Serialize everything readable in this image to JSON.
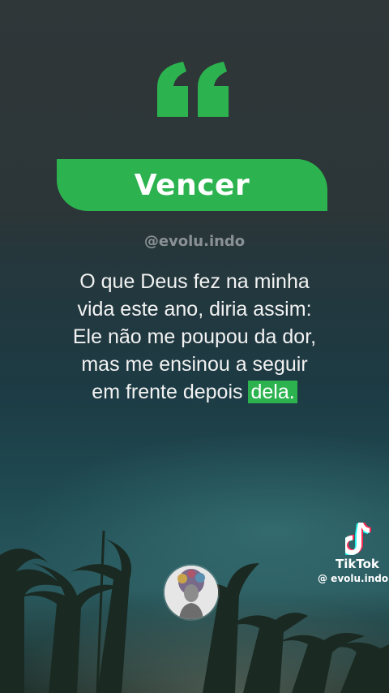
{
  "quote_card": {
    "title": "Vencer",
    "handle": "@evolu.indo",
    "lines": [
      "O que Deus fez na minha",
      "vida este ano, diria assim:",
      "Ele não me poupou da dor,",
      "mas me ensinou a seguir"
    ],
    "last_line_prefix": "em frente depois ",
    "last_line_highlight": "dela."
  },
  "watermark": {
    "brand": "TikTok",
    "username": "@ evolu.indo",
    "logo_icon": "tiktok-note-icon"
  },
  "colors": {
    "accent_green": "#2cb34f",
    "text_light": "#f2f2f2",
    "handle_gray": "#8a9196"
  }
}
